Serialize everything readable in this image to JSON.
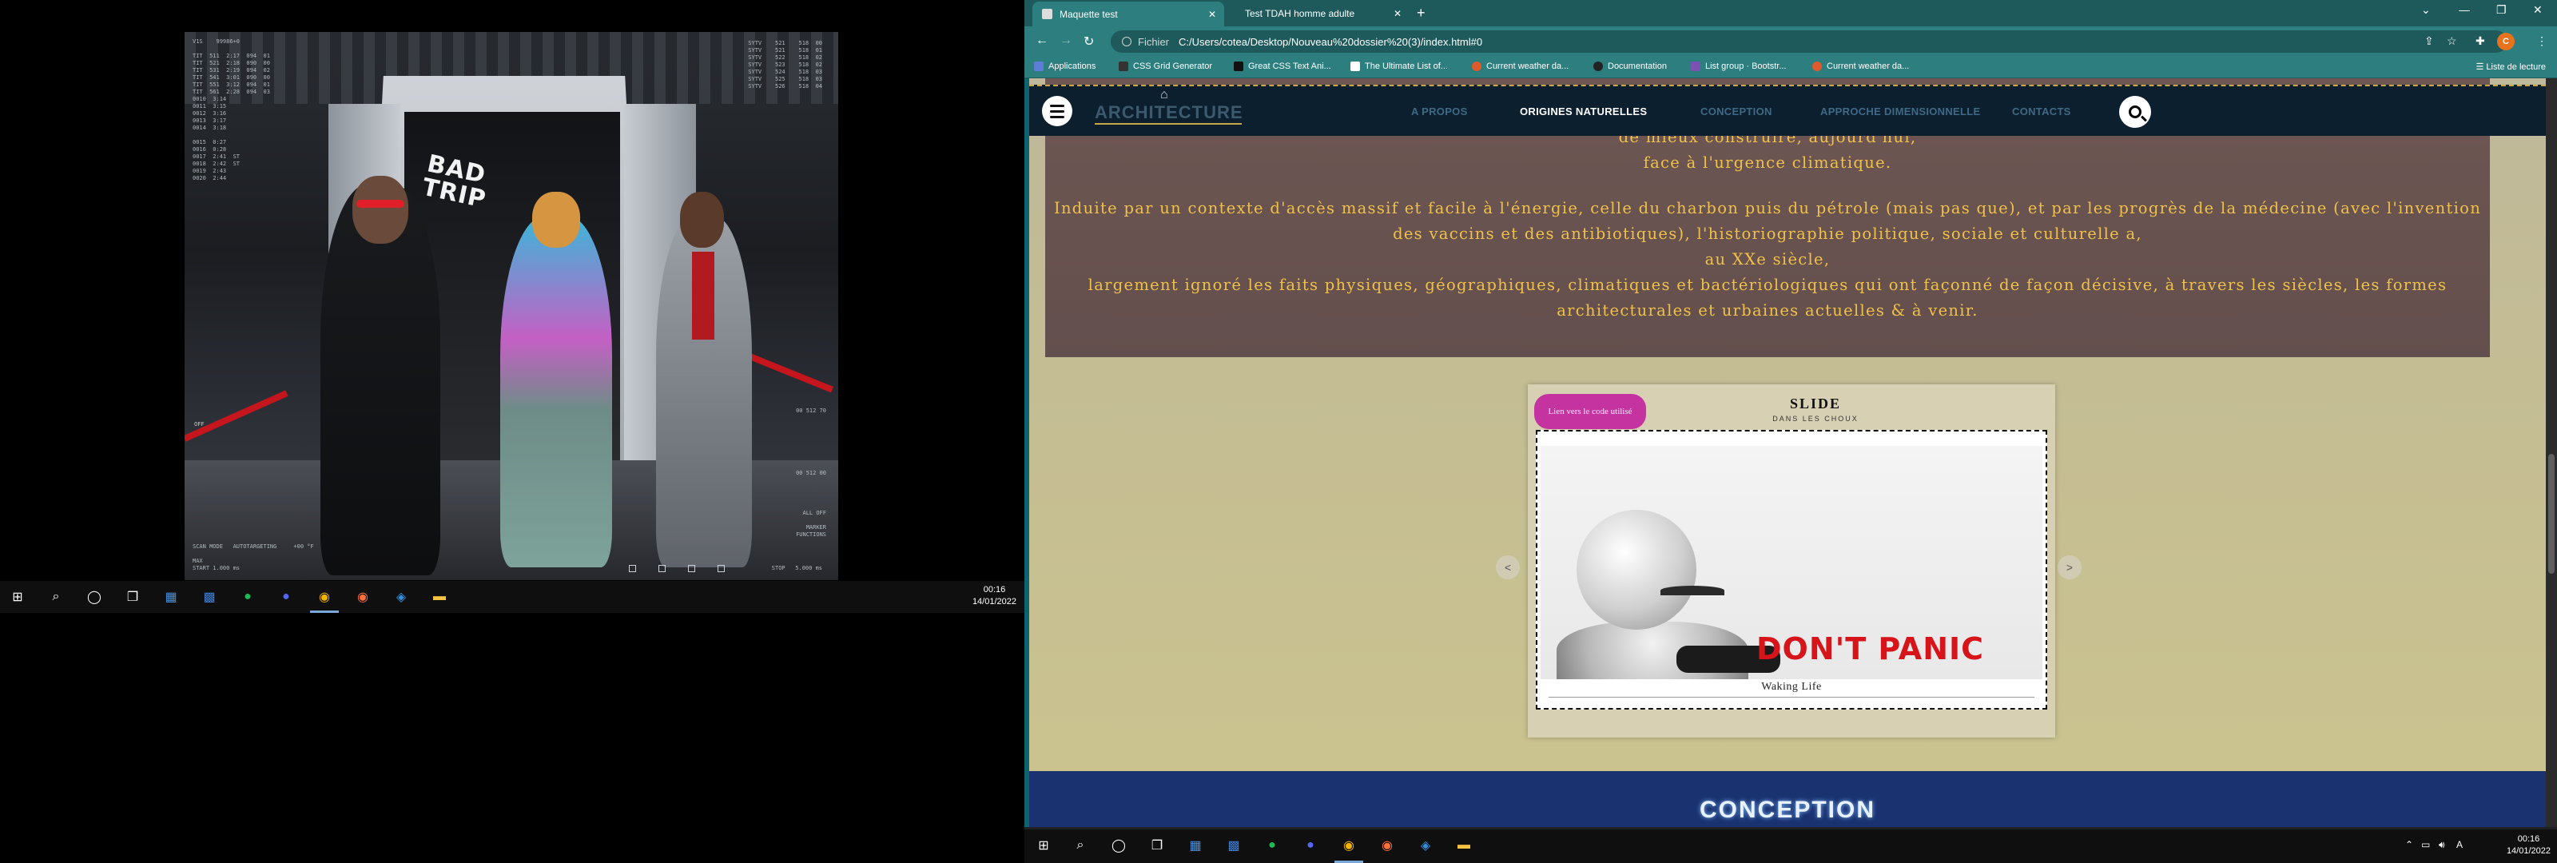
{
  "left_monitor": {
    "game": {
      "sign_text": "BAD\nTRIP",
      "hud_top_left": "V1S    99986+0\n\nTIT  511  2:17  094  01\nTIT  521  2:18  090  00\nTIT  531  2:19  094  02\nTIT  541  3:01  090  00\nTIT  551  3:12  094  01\nTIT  561  2:28  094  03\n0010  3:14\n0011  3:15\n0012  3:16\n0013  3:17\n0014  3:18\n\n0015  0:27\n0016  0:28\n0017  2:41  ST\n0018  2:42  ST\n0019  2:43\n0020  2:44",
      "hud_top_right": "SYTV    521    518  00\nSYTV    521    518  01\nSYTV    522    518  02\nSYTV    523    518  02\nSYTV    524    518  03\nSYTV    525    518  03\nSYTV    526    518  04",
      "hud_left_mid": "OFF",
      "hud_r1": "00 512 70",
      "hud_r2": "00 512 00",
      "hud_r3": "ALL OFF\n\nMARKER\nFUNCTIONS",
      "hud_bottom_left": "SCAN MODE   AUTOTARGETING     +00 °F\n\nMAX\nSTART 1.000 ms",
      "hud_bottom_right": "STOP   5.000 ms"
    },
    "taskbar": {
      "time": "00:16",
      "date": "14/01/2022",
      "icons": [
        "windows-icon",
        "search-icon",
        "cortana-icon",
        "task-view-icon",
        "calculator-icon",
        "photos-icon",
        "spotify-icon",
        "discord-icon",
        "chrome-icon",
        "firefox-icon",
        "vscode-icon",
        "file-explorer-icon"
      ]
    }
  },
  "browser": {
    "tabs": [
      {
        "label": "Maquette test",
        "active": true
      },
      {
        "label": "Test TDAH homme adulte",
        "active": false
      }
    ],
    "url_scheme": "Fichier",
    "url": "C:/Users/cotea/Desktop/Nouveau%20dossier%20(3)/index.html#0",
    "profile_initial": "C",
    "bookmarks": [
      {
        "label": "Applications",
        "color": "#5f7cd8"
      },
      {
        "label": "CSS Grid Generator",
        "color": "#333333"
      },
      {
        "label": "Great CSS Text Ani...",
        "color": "#111111"
      },
      {
        "label": "The Ultimate List of...",
        "color": "#111111"
      },
      {
        "label": "Current weather da...",
        "color": "#e05a2b"
      },
      {
        "label": "Documentation",
        "color": "#222222"
      },
      {
        "label": "List group · Bootstr...",
        "color": "#7952b3"
      },
      {
        "label": "Current weather da...",
        "color": "#e05a2b"
      }
    ],
    "reading_list": "Liste de lecture"
  },
  "site": {
    "logo": "ARCHITECTURE",
    "nav": [
      "A PROPOS",
      "ORIGINES NATURELLES",
      "CONCEPTION",
      "APPROCHE DIMENSIONNELLE",
      "CONTACTS"
    ],
    "active_nav": "ORIGINES NATURELLES",
    "text_top_line": "de mieux construire, aujourd'hui,",
    "text_top_line2": "face à l'urgence climatique.",
    "text_main": "Induite par un contexte d'accès massif et facile à l'énergie, celle du charbon puis du pétrole (mais pas que), et par les progrès de la médecine (avec l'invention des vaccins et des antibiotiques), l'historiographie politique, sociale et culturelle a,\nau XXe siècle,\nlargement ignoré les faits physiques, géographiques, climatiques et bactériologiques qui ont façonné de façon décisive, à travers les siècles, les formes architecturales et urbaines actuelles & à venir.",
    "slider": {
      "code_link": "Lien vers le code utilisé",
      "title": "SLIDE",
      "subtitle": "DANS LES CHOUX",
      "image_text": "DON'T PANIC",
      "caption": "Waking Life",
      "prev": "<",
      "next": ">"
    },
    "section_title": "CONCEPTION"
  },
  "right_taskbar": {
    "time": "00:16",
    "date": "14/01/2022"
  }
}
